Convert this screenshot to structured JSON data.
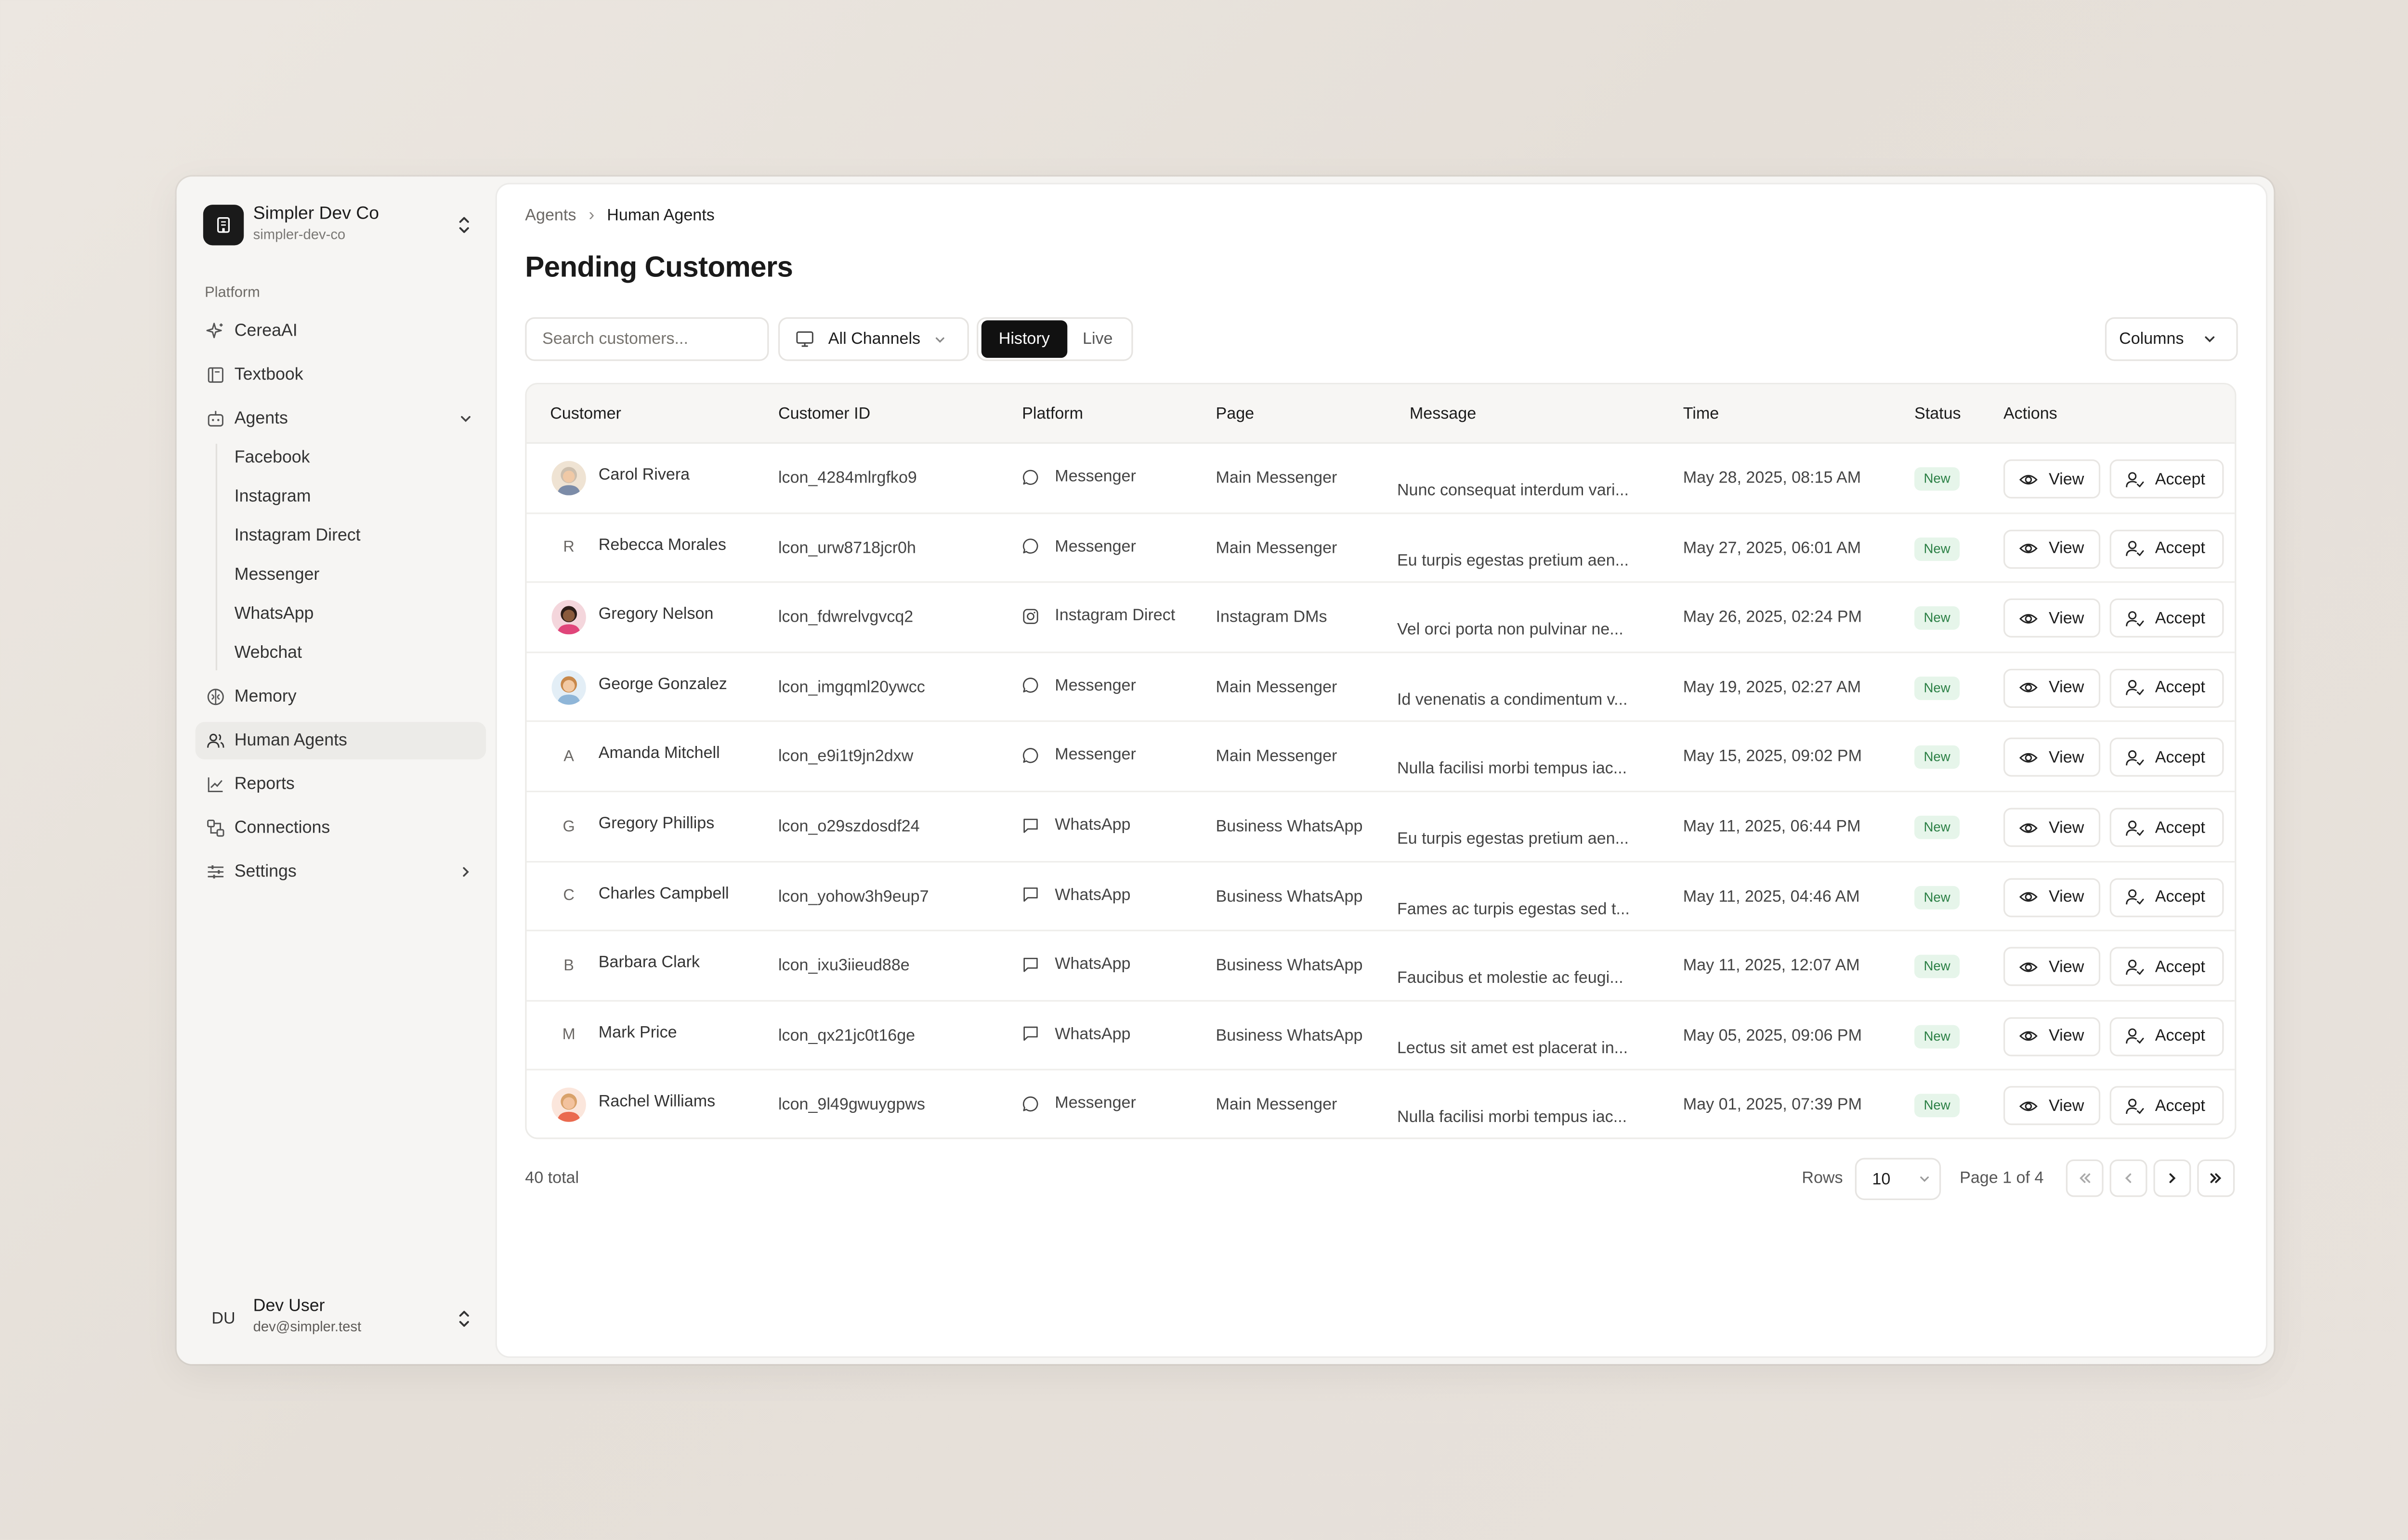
{
  "org": {
    "name": "Simpler Dev Co",
    "slug": "simpler-dev-co"
  },
  "sidebar": {
    "section_label": "Platform",
    "items": [
      {
        "label": "CereaAI",
        "icon": "sparkles-icon"
      },
      {
        "label": "Textbook",
        "icon": "book-icon"
      },
      {
        "label": "Agents",
        "icon": "bot-icon"
      },
      {
        "label": "Memory",
        "icon": "brain-icon"
      },
      {
        "label": "Human Agents",
        "icon": "users-icon"
      },
      {
        "label": "Reports",
        "icon": "chart-icon"
      },
      {
        "label": "Connections",
        "icon": "connections-icon"
      },
      {
        "label": "Settings",
        "icon": "sliders-icon"
      }
    ],
    "agents_sub": [
      "Facebook",
      "Instagram",
      "Instagram Direct",
      "Messenger",
      "WhatsApp",
      "Webchat"
    ],
    "active": "Human Agents"
  },
  "user": {
    "initials": "DU",
    "name": "Dev User",
    "email": "dev@simpler.test"
  },
  "breadcrumb": {
    "parent": "Agents",
    "current": "Human Agents"
  },
  "page_title": "Pending Customers",
  "toolbar": {
    "search_placeholder": "Search customers...",
    "channel_filter": "All Channels",
    "history_label": "History",
    "live_label": "Live",
    "columns_label": "Columns"
  },
  "table": {
    "headers": [
      "Customer",
      "Customer ID",
      "Platform",
      "Page",
      "Message",
      "Time",
      "Status",
      "Actions"
    ],
    "view_label": "View",
    "accept_label": "Accept",
    "rows": [
      {
        "name": "Carol Rivera",
        "avatar": "photo",
        "id": "lcon_4284mlrgfko9",
        "platform": "Messenger",
        "page": "Main Messenger",
        "message": "Nunc consequat interdum vari...",
        "time": "May 28, 2025, 08:15 AM",
        "status": "New"
      },
      {
        "name": "Rebecca Morales",
        "avatar": "R",
        "id": "lcon_urw8718jcr0h",
        "platform": "Messenger",
        "page": "Main Messenger",
        "message": "Eu turpis egestas pretium aen...",
        "time": "May 27, 2025, 06:01 AM",
        "status": "New"
      },
      {
        "name": "Gregory Nelson",
        "avatar": "photo",
        "id": "lcon_fdwrelvgvcq2",
        "platform": "Instagram Direct",
        "page": "Instagram DMs",
        "message": "Vel orci porta non pulvinar ne...",
        "time": "May 26, 2025, 02:24 PM",
        "status": "New"
      },
      {
        "name": "George Gonzalez",
        "avatar": "photo",
        "id": "lcon_imgqml20ywcc",
        "platform": "Messenger",
        "page": "Main Messenger",
        "message": "Id venenatis a condimentum v...",
        "time": "May 19, 2025, 02:27 AM",
        "status": "New"
      },
      {
        "name": "Amanda Mitchell",
        "avatar": "A",
        "id": "lcon_e9i1t9jn2dxw",
        "platform": "Messenger",
        "page": "Main Messenger",
        "message": "Nulla facilisi morbi tempus iac...",
        "time": "May 15, 2025, 09:02 PM",
        "status": "New"
      },
      {
        "name": "Gregory Phillips",
        "avatar": "G",
        "id": "lcon_o29szdosdf24",
        "platform": "WhatsApp",
        "page": "Business WhatsApp",
        "message": "Eu turpis egestas pretium aen...",
        "time": "May 11, 2025, 06:44 PM",
        "status": "New"
      },
      {
        "name": "Charles Campbell",
        "avatar": "C",
        "id": "lcon_yohow3h9eup7",
        "platform": "WhatsApp",
        "page": "Business WhatsApp",
        "message": "Fames ac turpis egestas sed t...",
        "time": "May 11, 2025, 04:46 AM",
        "status": "New"
      },
      {
        "name": "Barbara Clark",
        "avatar": "B",
        "id": "lcon_ixu3iieud88e",
        "platform": "WhatsApp",
        "page": "Business WhatsApp",
        "message": "Faucibus et molestie ac feugi...",
        "time": "May 11, 2025, 12:07 AM",
        "status": "New"
      },
      {
        "name": "Mark Price",
        "avatar": "M",
        "id": "lcon_qx21jc0t16ge",
        "platform": "WhatsApp",
        "page": "Business WhatsApp",
        "message": "Lectus sit amet est placerat in...",
        "time": "May 05, 2025, 09:06 PM",
        "status": "New"
      },
      {
        "name": "Rachel Williams",
        "avatar": "photo",
        "id": "lcon_9l49gwuygpws",
        "platform": "Messenger",
        "page": "Main Messenger",
        "message": "Nulla facilisi morbi tempus iac...",
        "time": "May 01, 2025, 07:39 PM",
        "status": "New"
      }
    ]
  },
  "footer": {
    "total": "40 total",
    "rows_label": "Rows",
    "rows_value": "10",
    "page_label": "Page 1 of 4"
  },
  "colors": {
    "badge_bg": "#e6f5ea",
    "badge_text": "#2a7f44",
    "primary": "#111111"
  }
}
